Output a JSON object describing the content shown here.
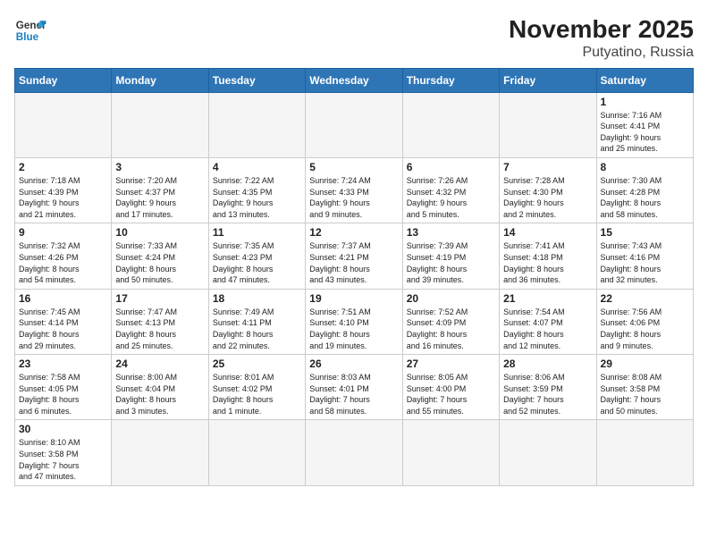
{
  "header": {
    "logo_general": "General",
    "logo_blue": "Blue",
    "title": "November 2025",
    "subtitle": "Putyatino, Russia"
  },
  "weekdays": [
    "Sunday",
    "Monday",
    "Tuesday",
    "Wednesday",
    "Thursday",
    "Friday",
    "Saturday"
  ],
  "weeks": [
    [
      {
        "day": "",
        "info": ""
      },
      {
        "day": "",
        "info": ""
      },
      {
        "day": "",
        "info": ""
      },
      {
        "day": "",
        "info": ""
      },
      {
        "day": "",
        "info": ""
      },
      {
        "day": "",
        "info": ""
      },
      {
        "day": "1",
        "info": "Sunrise: 7:16 AM\nSunset: 4:41 PM\nDaylight: 9 hours\nand 25 minutes."
      }
    ],
    [
      {
        "day": "2",
        "info": "Sunrise: 7:18 AM\nSunset: 4:39 PM\nDaylight: 9 hours\nand 21 minutes."
      },
      {
        "day": "3",
        "info": "Sunrise: 7:20 AM\nSunset: 4:37 PM\nDaylight: 9 hours\nand 17 minutes."
      },
      {
        "day": "4",
        "info": "Sunrise: 7:22 AM\nSunset: 4:35 PM\nDaylight: 9 hours\nand 13 minutes."
      },
      {
        "day": "5",
        "info": "Sunrise: 7:24 AM\nSunset: 4:33 PM\nDaylight: 9 hours\nand 9 minutes."
      },
      {
        "day": "6",
        "info": "Sunrise: 7:26 AM\nSunset: 4:32 PM\nDaylight: 9 hours\nand 5 minutes."
      },
      {
        "day": "7",
        "info": "Sunrise: 7:28 AM\nSunset: 4:30 PM\nDaylight: 9 hours\nand 2 minutes."
      },
      {
        "day": "8",
        "info": "Sunrise: 7:30 AM\nSunset: 4:28 PM\nDaylight: 8 hours\nand 58 minutes."
      }
    ],
    [
      {
        "day": "9",
        "info": "Sunrise: 7:32 AM\nSunset: 4:26 PM\nDaylight: 8 hours\nand 54 minutes."
      },
      {
        "day": "10",
        "info": "Sunrise: 7:33 AM\nSunset: 4:24 PM\nDaylight: 8 hours\nand 50 minutes."
      },
      {
        "day": "11",
        "info": "Sunrise: 7:35 AM\nSunset: 4:23 PM\nDaylight: 8 hours\nand 47 minutes."
      },
      {
        "day": "12",
        "info": "Sunrise: 7:37 AM\nSunset: 4:21 PM\nDaylight: 8 hours\nand 43 minutes."
      },
      {
        "day": "13",
        "info": "Sunrise: 7:39 AM\nSunset: 4:19 PM\nDaylight: 8 hours\nand 39 minutes."
      },
      {
        "day": "14",
        "info": "Sunrise: 7:41 AM\nSunset: 4:18 PM\nDaylight: 8 hours\nand 36 minutes."
      },
      {
        "day": "15",
        "info": "Sunrise: 7:43 AM\nSunset: 4:16 PM\nDaylight: 8 hours\nand 32 minutes."
      }
    ],
    [
      {
        "day": "16",
        "info": "Sunrise: 7:45 AM\nSunset: 4:14 PM\nDaylight: 8 hours\nand 29 minutes."
      },
      {
        "day": "17",
        "info": "Sunrise: 7:47 AM\nSunset: 4:13 PM\nDaylight: 8 hours\nand 25 minutes."
      },
      {
        "day": "18",
        "info": "Sunrise: 7:49 AM\nSunset: 4:11 PM\nDaylight: 8 hours\nand 22 minutes."
      },
      {
        "day": "19",
        "info": "Sunrise: 7:51 AM\nSunset: 4:10 PM\nDaylight: 8 hours\nand 19 minutes."
      },
      {
        "day": "20",
        "info": "Sunrise: 7:52 AM\nSunset: 4:09 PM\nDaylight: 8 hours\nand 16 minutes."
      },
      {
        "day": "21",
        "info": "Sunrise: 7:54 AM\nSunset: 4:07 PM\nDaylight: 8 hours\nand 12 minutes."
      },
      {
        "day": "22",
        "info": "Sunrise: 7:56 AM\nSunset: 4:06 PM\nDaylight: 8 hours\nand 9 minutes."
      }
    ],
    [
      {
        "day": "23",
        "info": "Sunrise: 7:58 AM\nSunset: 4:05 PM\nDaylight: 8 hours\nand 6 minutes."
      },
      {
        "day": "24",
        "info": "Sunrise: 8:00 AM\nSunset: 4:04 PM\nDaylight: 8 hours\nand 3 minutes."
      },
      {
        "day": "25",
        "info": "Sunrise: 8:01 AM\nSunset: 4:02 PM\nDaylight: 8 hours\nand 1 minute."
      },
      {
        "day": "26",
        "info": "Sunrise: 8:03 AM\nSunset: 4:01 PM\nDaylight: 7 hours\nand 58 minutes."
      },
      {
        "day": "27",
        "info": "Sunrise: 8:05 AM\nSunset: 4:00 PM\nDaylight: 7 hours\nand 55 minutes."
      },
      {
        "day": "28",
        "info": "Sunrise: 8:06 AM\nSunset: 3:59 PM\nDaylight: 7 hours\nand 52 minutes."
      },
      {
        "day": "29",
        "info": "Sunrise: 8:08 AM\nSunset: 3:58 PM\nDaylight: 7 hours\nand 50 minutes."
      }
    ],
    [
      {
        "day": "30",
        "info": "Sunrise: 8:10 AM\nSunset: 3:58 PM\nDaylight: 7 hours\nand 47 minutes."
      },
      {
        "day": "",
        "info": ""
      },
      {
        "day": "",
        "info": ""
      },
      {
        "day": "",
        "info": ""
      },
      {
        "day": "",
        "info": ""
      },
      {
        "day": "",
        "info": ""
      },
      {
        "day": "",
        "info": ""
      }
    ]
  ]
}
